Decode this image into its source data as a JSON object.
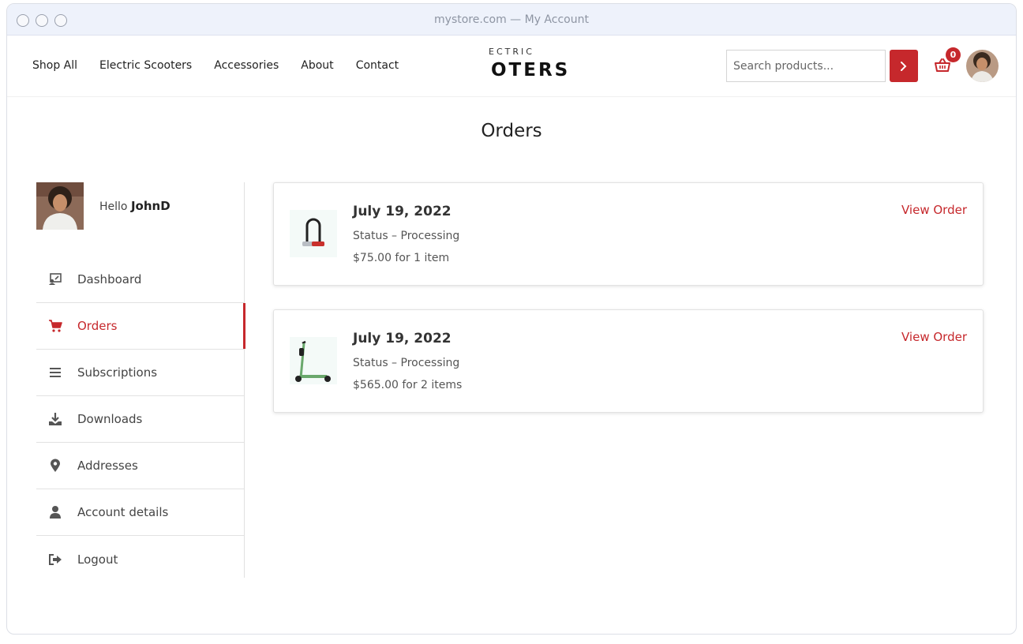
{
  "window": {
    "title": "mystore.com — My Account"
  },
  "nav": [
    "Shop All",
    "Electric Scooters",
    "Accessories",
    "About",
    "Contact"
  ],
  "logo": {
    "top": "ECTRIC",
    "main": "OTERS"
  },
  "search": {
    "placeholder": "Search products..."
  },
  "cart": {
    "count": "0"
  },
  "page": {
    "title": "Orders"
  },
  "sidebar": {
    "hello_prefix": "Hello",
    "username": "JohnD",
    "items": [
      {
        "label": "Dashboard",
        "icon": "dashboard-icon"
      },
      {
        "label": "Orders",
        "icon": "cart-icon"
      },
      {
        "label": "Subscriptions",
        "icon": "list-icon"
      },
      {
        "label": "Downloads",
        "icon": "download-icon"
      },
      {
        "label": "Addresses",
        "icon": "location-pin-icon"
      },
      {
        "label": "Account details",
        "icon": "user-icon"
      },
      {
        "label": "Logout",
        "icon": "logout-icon"
      }
    ]
  },
  "orders": [
    {
      "date": "July 19, 2022",
      "status": "Status – Processing",
      "total": "$75.00 for 1 item",
      "action": "View Order",
      "thumb": "u-lock-icon"
    },
    {
      "date": "July 19, 2022",
      "status": "Status – Processing",
      "total": "$565.00 for 2 items",
      "action": "View Order",
      "thumb": "scooter-icon"
    }
  ],
  "colors": {
    "accent": "#c6282c"
  }
}
